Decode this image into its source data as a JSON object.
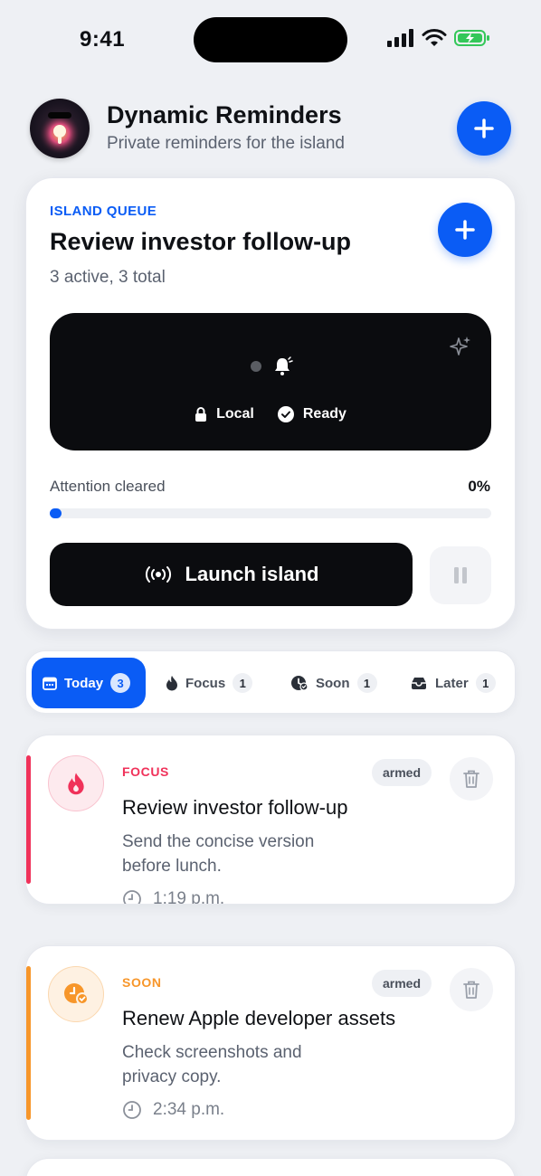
{
  "status_bar": {
    "time": "9:41"
  },
  "header": {
    "title": "Dynamic Reminders",
    "subtitle": "Private reminders for the island"
  },
  "island_card": {
    "eyebrow": "ISLAND QUEUE",
    "title": "Review investor follow-up",
    "count": "3 active, 3 total",
    "chips": {
      "local": "Local",
      "ready": "Ready"
    },
    "progress": {
      "label": "Attention cleared",
      "value_text": "0%",
      "value": 0
    },
    "launch_label": "Launch island"
  },
  "tabs": [
    {
      "label": "Today",
      "count": "3",
      "active": true
    },
    {
      "label": "Focus",
      "count": "1",
      "active": false
    },
    {
      "label": "Soon",
      "count": "1",
      "active": false
    },
    {
      "label": "Later",
      "count": "1",
      "active": false
    }
  ],
  "reminders": [
    {
      "category": "FOCUS",
      "title": "Review investor follow-up",
      "note": "Send the concise version before lunch.",
      "time": "1:19 p.m.",
      "badge": "armed",
      "accent": "#f0325a"
    },
    {
      "category": "SOON",
      "title": "Renew Apple developer assets",
      "note": "Check screenshots and privacy copy.",
      "time": "2:34 p.m.",
      "badge": "armed",
      "accent": "#f7962a"
    }
  ],
  "colors": {
    "primary": "#0a5cf5",
    "focus": "#f0325a",
    "soon": "#f7962a",
    "dark": "#0b0c0f"
  }
}
